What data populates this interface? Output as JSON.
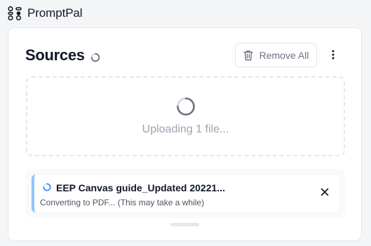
{
  "app": {
    "name": "PromptPal",
    "logo_icon": "dots-network-icon"
  },
  "sources": {
    "title": "Sources",
    "remove_all_label": "Remove All",
    "remove_icon": "trash-icon",
    "more_icon": "kebab-menu-icon",
    "dropzone": {
      "status_text": "Uploading 1 file..."
    },
    "files": [
      {
        "name": "EEP Canvas guide_Updated 20221...",
        "status": "Converting to PDF... (This may take a while)"
      }
    ]
  },
  "colors": {
    "accent_border": "#93c5fd",
    "spinner": "#6b7280",
    "file_spinner": "#3b82f6"
  }
}
